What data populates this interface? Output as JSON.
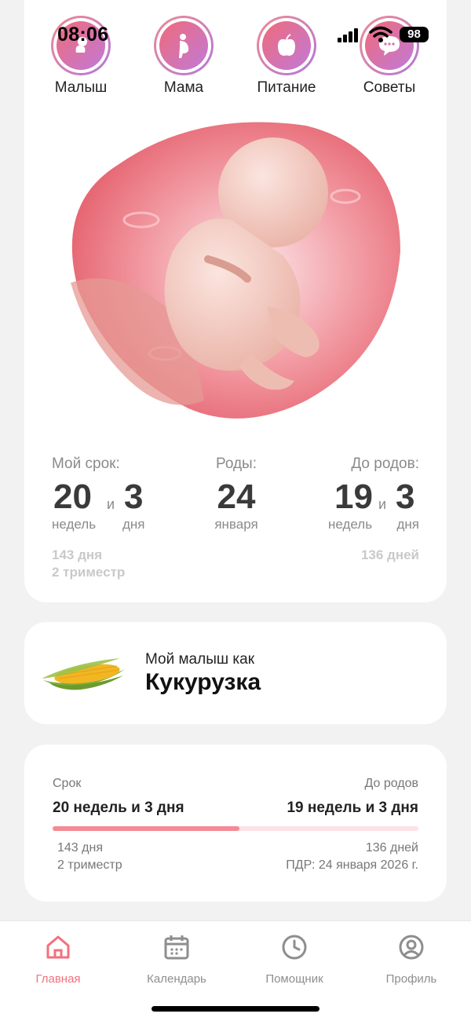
{
  "status_bar": {
    "time": "08:06",
    "battery": "98"
  },
  "categories": [
    {
      "label": "Малыш",
      "icon": "baby-icon"
    },
    {
      "label": "Мама",
      "icon": "pregnant-woman-icon"
    },
    {
      "label": "Питание",
      "icon": "apple-icon"
    },
    {
      "label": "Советы",
      "icon": "chat-bubble-icon"
    }
  ],
  "stats": {
    "term": {
      "label": "Мой срок:",
      "weeks": "20",
      "and": "и",
      "days": "3",
      "weeks_unit": "недель",
      "days_unit": "дня"
    },
    "birth": {
      "label": "Роды:",
      "day": "24",
      "month": "января"
    },
    "remaining": {
      "label": "До родов:",
      "weeks": "19",
      "and": "и",
      "days": "3",
      "weeks_unit": "недель",
      "days_unit": "дня"
    },
    "total_days": "143 дня",
    "trimester": "2 триместр",
    "remaining_days": "136 дней"
  },
  "fruit": {
    "subtitle": "Мой малыш как",
    "name": "Кукурузка",
    "icon": "corn-icon"
  },
  "progress": {
    "term_label": "Срок",
    "term_value": "20 недель и 3 дня",
    "remaining_label": "До родов",
    "remaining_value": "19 недель и 3 дня",
    "percent": 51,
    "days": "143 дня",
    "trimester": "2 триместр",
    "remaining_days": "136 дней",
    "due_date": "ПДР: 24 января 2026 г."
  },
  "tabs": [
    {
      "label": "Главная",
      "icon": "home-icon",
      "active": true
    },
    {
      "label": "Календарь",
      "icon": "calendar-icon",
      "active": false
    },
    {
      "label": "Помощник",
      "icon": "clock-icon",
      "active": false
    },
    {
      "label": "Профиль",
      "icon": "profile-icon",
      "active": false
    }
  ],
  "colors": {
    "accent": "#f3707d",
    "progress_track": "#fde1e4",
    "progress_fill": "#f38b95",
    "inactive_tab": "#8e8e8e"
  }
}
